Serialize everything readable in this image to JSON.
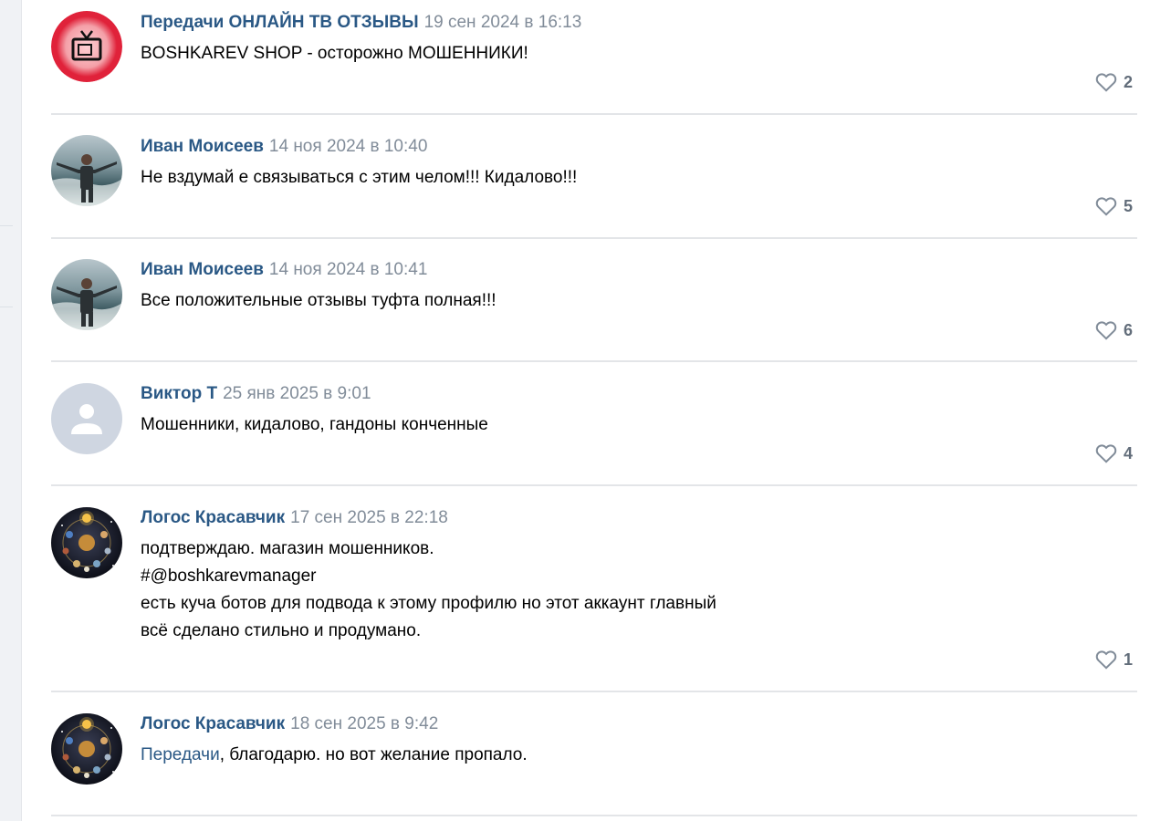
{
  "comments": [
    {
      "author": "Передачи ОНЛАЙН ТВ ОТЗЫВЫ",
      "date": "19 сен 2024 в 16:13",
      "lines": [
        "BOSHKAREV SHOP - осторожно МОШЕННИКИ!"
      ],
      "likes": "2",
      "avatar": "tv-icon"
    },
    {
      "author": "Иван Моисеев",
      "date": "14 ноя 2024 в 10:40",
      "lines": [
        "Не вздумай е связываться с этим челом!!! Кидалово!!!"
      ],
      "likes": "5",
      "avatar": "photo-beach"
    },
    {
      "author": "Иван Моисеев",
      "date": "14 ноя 2024 в 10:41",
      "lines": [
        "Все положительные отзывы туфта полная!!!"
      ],
      "likes": "6",
      "avatar": "photo-beach"
    },
    {
      "author": "Виктор Т",
      "date": "25 янв 2025 в 9:01",
      "lines": [
        "Мошенники, кидалово, гандоны конченные"
      ],
      "likes": "4",
      "avatar": "default-user-icon"
    },
    {
      "author": "Логос Красавчик",
      "date": "17 сен 2025 в 22:18",
      "lines": [
        "подтверждаю. магазин мошенников.",
        "#@boshkarevmanager",
        "есть куча ботов для подвода к этому профилю но этот аккаунт главный",
        "всё сделано стильно и продумано."
      ],
      "likes": "1",
      "avatar": "planets-image"
    },
    {
      "author": "Логос Красавчик",
      "date": "18 сен 2025 в 9:42",
      "mention": "Передачи",
      "lines": [
        ", благодарю. но вот желание пропало."
      ],
      "likes": "",
      "avatar": "planets-image"
    }
  ],
  "colors": {
    "link": "#2a5885",
    "date": "#818c99",
    "like": "#626d7a",
    "divider": "#e3e5e8"
  }
}
